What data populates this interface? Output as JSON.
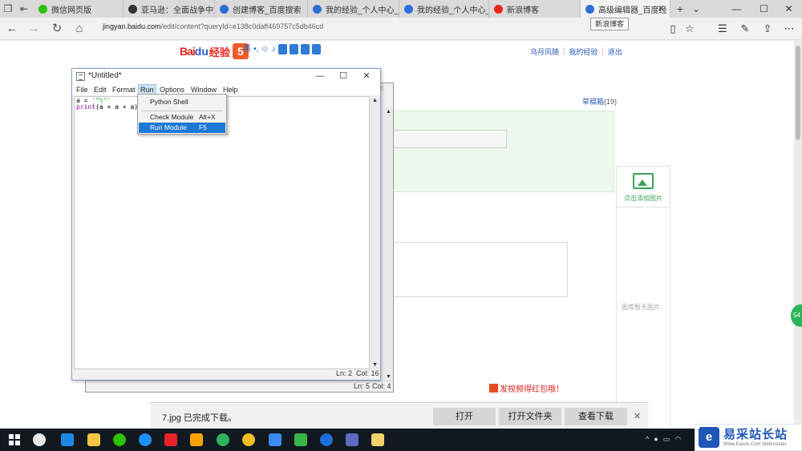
{
  "browser": {
    "tabs": [
      {
        "label": "微信网页版",
        "color": "#2dc100"
      },
      {
        "label": "亚马逊：全面战争中文",
        "color": "#333333"
      },
      {
        "label": "创建博客_百度搜索",
        "color": "#2d6fd6"
      },
      {
        "label": "我的经验_个人中心_百",
        "color": "#2d6fd6"
      },
      {
        "label": "我的经验_个人中心_百",
        "color": "#2d6fd6"
      },
      {
        "label": "新浪博客",
        "color": "#e8241a"
      },
      {
        "label": "高级编辑器_百度经",
        "color": "#2d6fd6"
      }
    ],
    "new_tab": "+",
    "tab_list": "⌄",
    "tooltip": "新浪博客",
    "url_host": "jingyan.baidu.com",
    "url_path": "/edit/content?queryId=e138c0daff469757c5db46cd",
    "window_controls": {
      "minimize": "—",
      "maximize": "☐",
      "close": "✕"
    }
  },
  "site": {
    "logo_bai": "Bai",
    "logo_du": "du",
    "logo_jy": "经验",
    "logo_five": "5",
    "ime_label": "英",
    "links": [
      "乌月风随",
      "我的经验",
      "退出"
    ],
    "draft_label": "草稿箱",
    "draft_count": "(19)",
    "add_image": "点击添加图片",
    "no_image": "图库暂无图片",
    "promo": "发视频得红包哦！",
    "side_badge": "54"
  },
  "idle_shell": {
    "status_ln": "Ln: 5",
    "status_col": "Col: 4"
  },
  "editor": {
    "title": "*Untitled*",
    "menu": [
      "File",
      "Edit",
      "Format",
      "Run",
      "Options",
      "Window",
      "Help"
    ],
    "code": {
      "l1_prefix": "a = ",
      "l1_string": "'^\\^'",
      "l2_keyword": "print",
      "l2_rest": "(a + a + a)"
    },
    "status_ln": "Ln: 2",
    "status_col": "Col: 16",
    "controls": {
      "minimize": "—",
      "maximize": "☐",
      "close": "✕"
    }
  },
  "run_menu": {
    "items": [
      {
        "label": "Python Shell",
        "accel": ""
      },
      {
        "label": "Check Module",
        "accel": "Alt+X"
      },
      {
        "label": "Run Module",
        "accel": "F5"
      }
    ]
  },
  "download": {
    "message": "7.jpg 已完成下载。",
    "open": "打开",
    "open_folder": "打开文件夹",
    "view_downloads": "查看下载",
    "close": "✕"
  },
  "watermark": {
    "logo": "e",
    "cn": "易采站长站",
    "en": "Www.Easck.Com  Webmaster"
  }
}
